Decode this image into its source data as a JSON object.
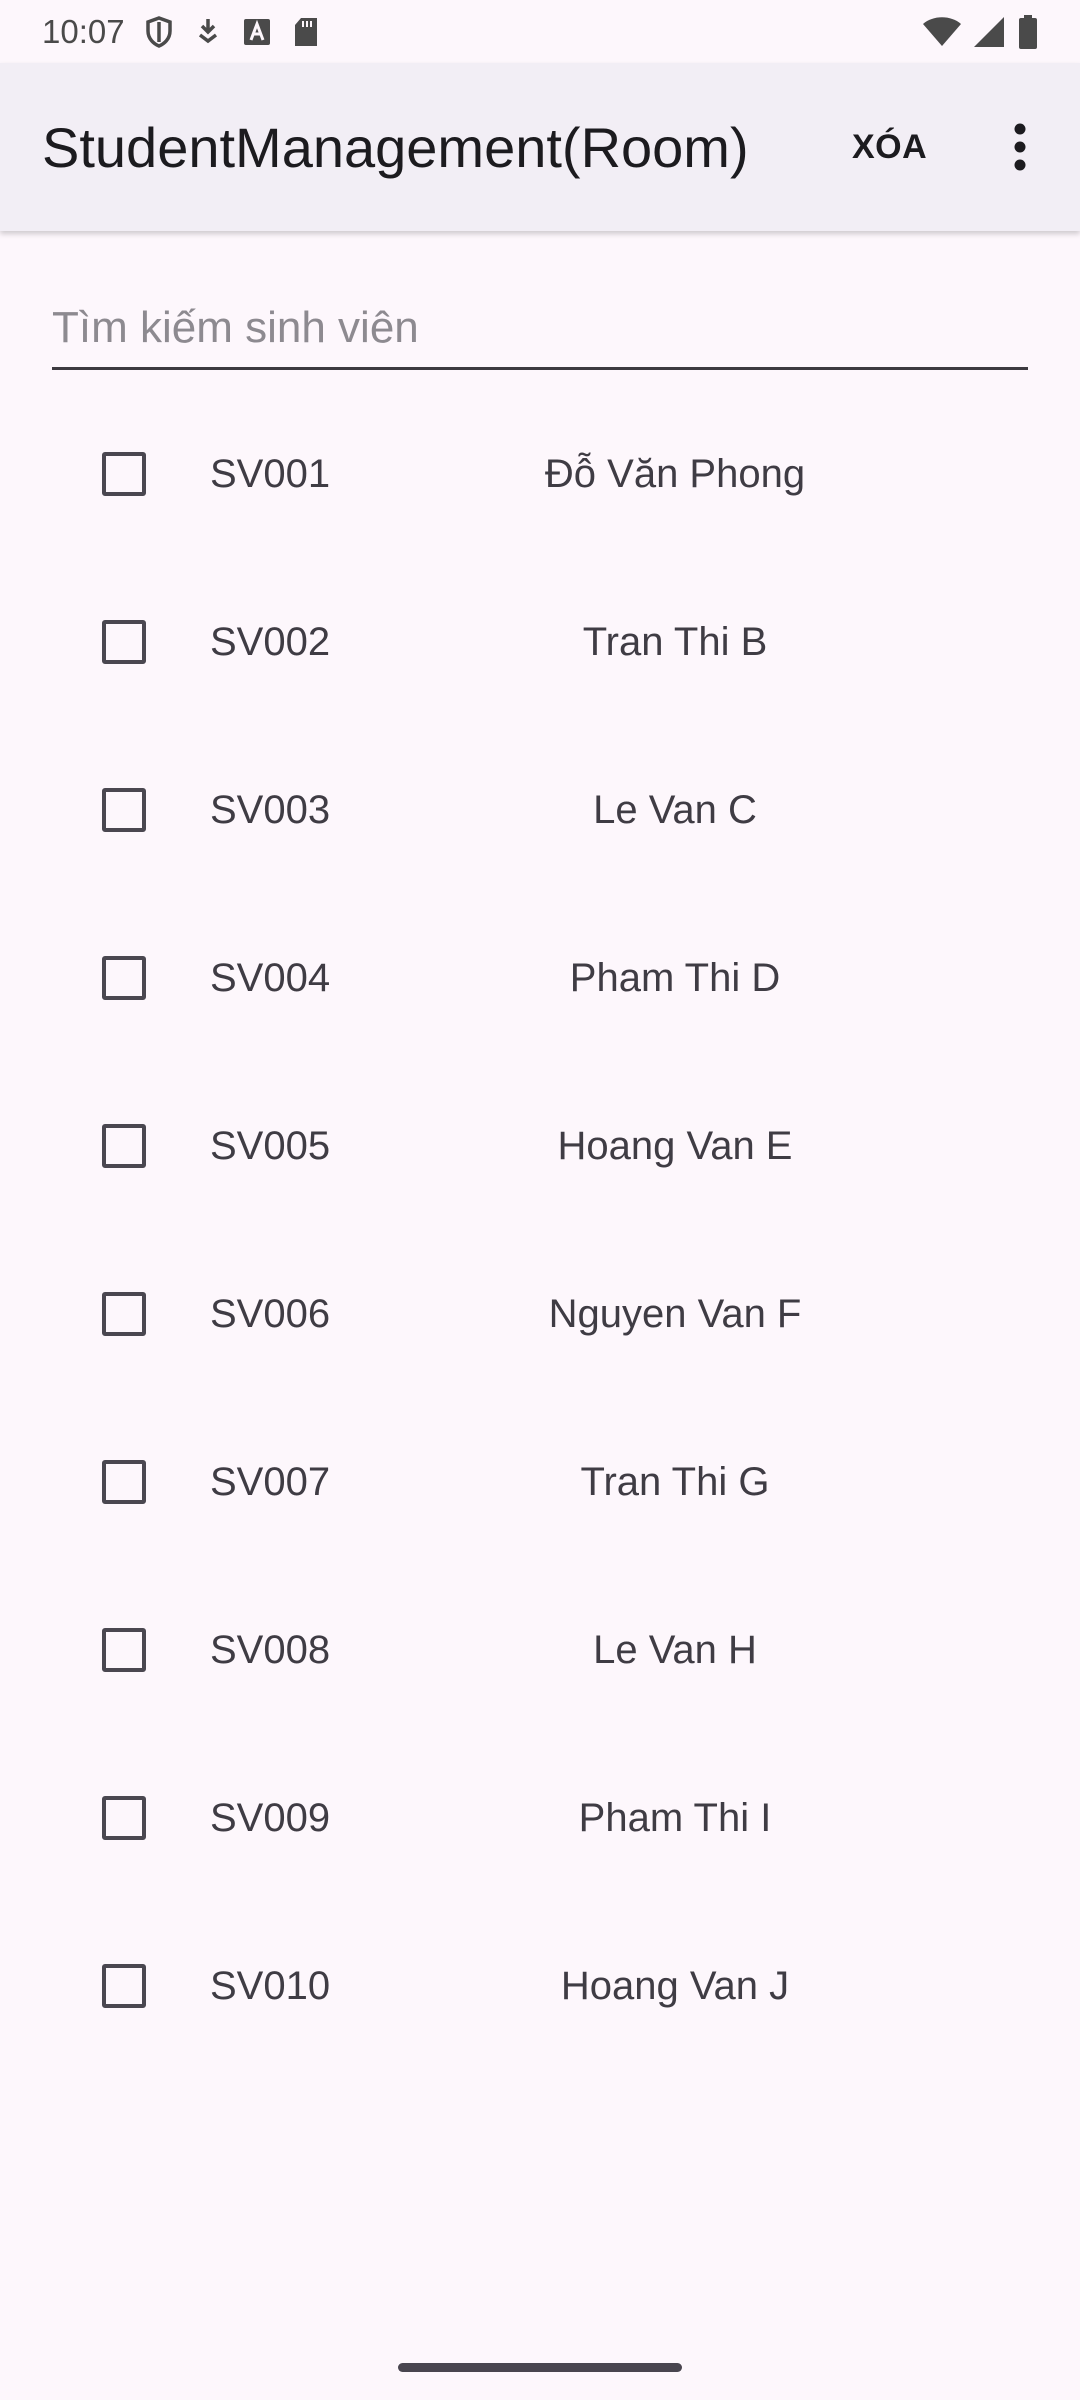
{
  "status_bar": {
    "time": "10:07",
    "icons_left": [
      "shield-icon",
      "download-icon",
      "keyboard-a-icon",
      "sd-card-icon"
    ],
    "icons_right": [
      "wifi-icon",
      "cellular-signal-icon",
      "battery-icon"
    ]
  },
  "app_bar": {
    "title": "StudentManagement(Room)",
    "delete_label": "XÓA",
    "overflow_icon": "more-vert-icon"
  },
  "search": {
    "placeholder": "Tìm kiếm sinh viên",
    "value": ""
  },
  "students": [
    {
      "id": "SV001",
      "name": "Đỗ Văn Phong",
      "checked": false
    },
    {
      "id": "SV002",
      "name": "Tran Thi B",
      "checked": false
    },
    {
      "id": "SV003",
      "name": "Le Van C",
      "checked": false
    },
    {
      "id": "SV004",
      "name": "Pham Thi D",
      "checked": false
    },
    {
      "id": "SV005",
      "name": "Hoang Van E",
      "checked": false
    },
    {
      "id": "SV006",
      "name": "Nguyen Van F",
      "checked": false
    },
    {
      "id": "SV007",
      "name": "Tran Thi G",
      "checked": false
    },
    {
      "id": "SV008",
      "name": "Le Van H",
      "checked": false
    },
    {
      "id": "SV009",
      "name": "Pham Thi I",
      "checked": false
    },
    {
      "id": "SV010",
      "name": "Hoang Van J",
      "checked": false
    }
  ],
  "colors": {
    "background": "#fdf7fc",
    "app_bar": "#f2eef5",
    "text": "#1c1b1f",
    "secondary_text": "#3f3c44"
  }
}
